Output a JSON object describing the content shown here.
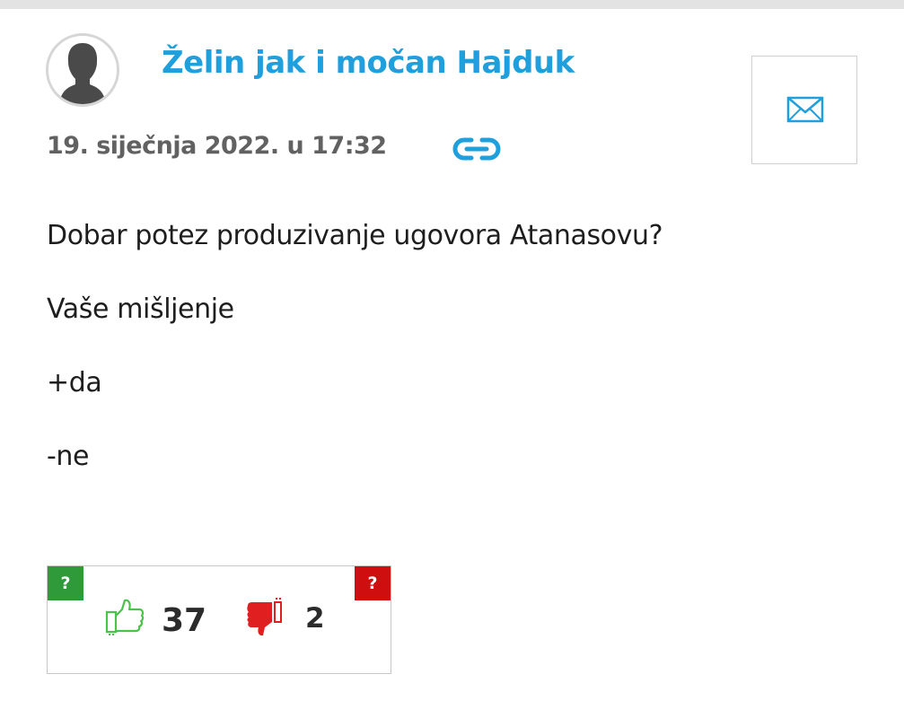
{
  "post": {
    "author": "Želin jak i močan Hajduk",
    "date": "19. siječnja 2022. u 17:32",
    "body": [
      "Dobar potez produzivanje ugovora Atanasovu?",
      "Vaše mišljenje",
      "+da",
      "-ne"
    ]
  },
  "votes": {
    "help_label": "?",
    "up_count": "37",
    "down_count": "2"
  },
  "icons": {
    "avatar": "default-avatar-silhouette",
    "message": "envelope-icon",
    "permalink": "link-icon",
    "vote_up": "thumbs-up-icon",
    "vote_down": "thumbs-down-icon"
  },
  "colors": {
    "accent": "#1fa0dc",
    "positive": "#2e9a3a",
    "negative": "#cf0f0f",
    "thumb_up": "#4bc24b",
    "thumb_down": "#e02020"
  }
}
